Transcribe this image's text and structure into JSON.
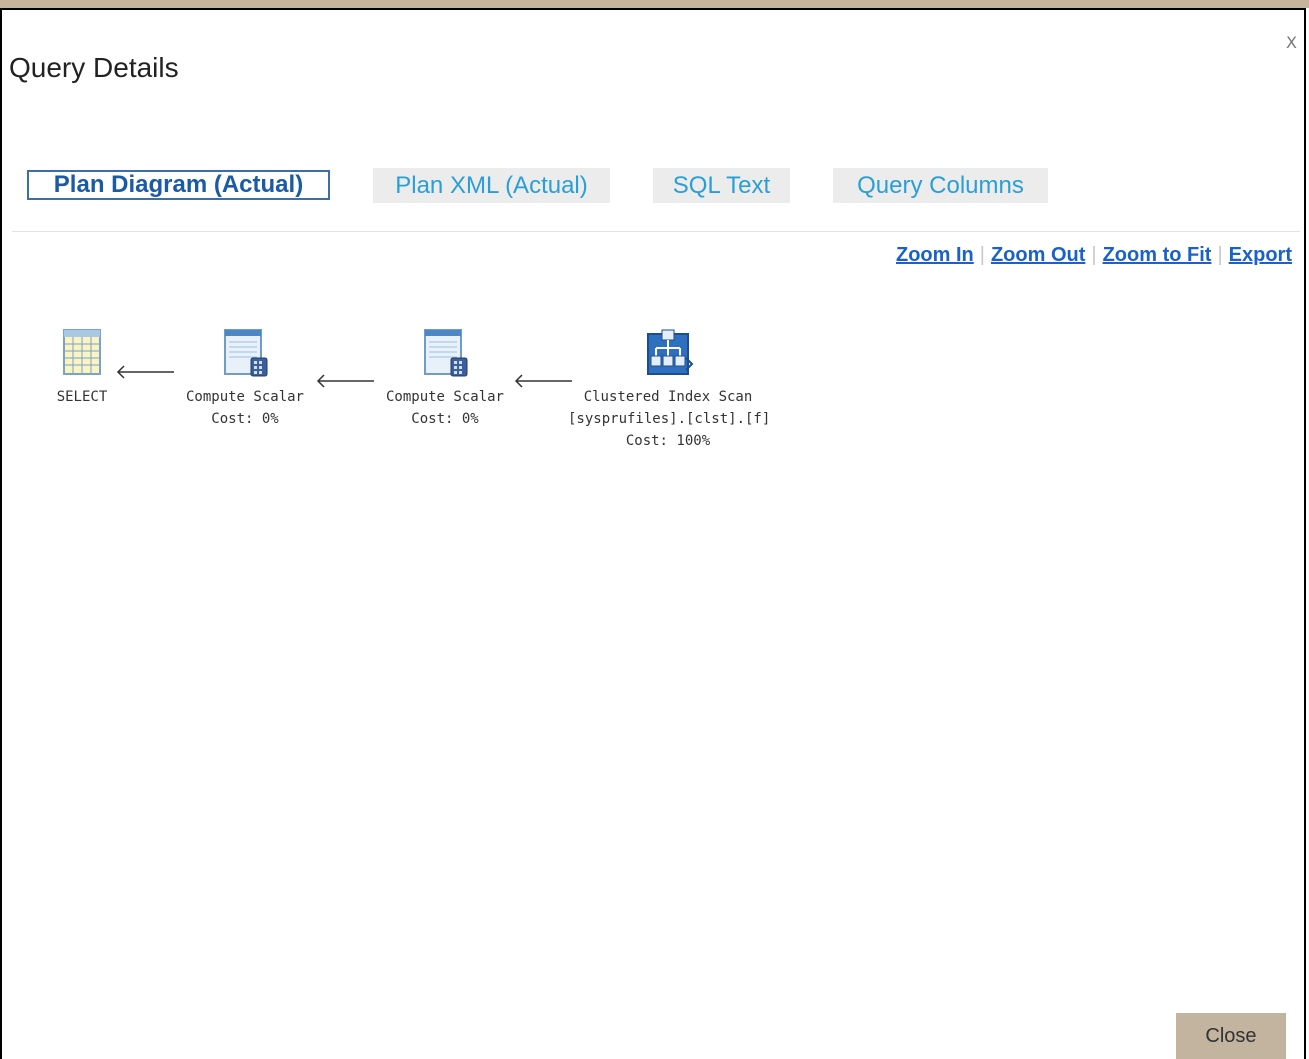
{
  "dialog": {
    "title": "Query Details",
    "close_glyph": "X",
    "close_button": "Close"
  },
  "tabs": [
    {
      "label": "Plan Diagram (Actual)",
      "active": true
    },
    {
      "label": "Plan XML (Actual)",
      "active": false
    },
    {
      "label": "SQL Text",
      "active": false
    },
    {
      "label": "Query Columns",
      "active": false
    }
  ],
  "zoom": {
    "zoom_in": "Zoom In",
    "zoom_out": "Zoom Out",
    "zoom_to_fit": "Zoom to Fit",
    "export": "Export",
    "separator": "|"
  },
  "plan": {
    "nodes": [
      {
        "icon": "select-table-icon",
        "lines": [
          "SELECT"
        ]
      },
      {
        "icon": "compute-scalar-icon",
        "lines": [
          "Compute Scalar",
          "Cost: 0%"
        ]
      },
      {
        "icon": "compute-scalar-icon",
        "lines": [
          "Compute Scalar",
          "Cost: 0%"
        ]
      },
      {
        "icon": "clustered-index-scan-icon",
        "lines": [
          "Clustered Index Scan",
          "[sysprufiles].[clst].[f]",
          "Cost: 100%"
        ]
      }
    ]
  },
  "colors": {
    "accent": "#2a9fd6",
    "link": "#1a62c6",
    "active_tab_border": "#3a6fa8",
    "button_bg": "#c2b49e",
    "top_band": "#c6b59c"
  }
}
